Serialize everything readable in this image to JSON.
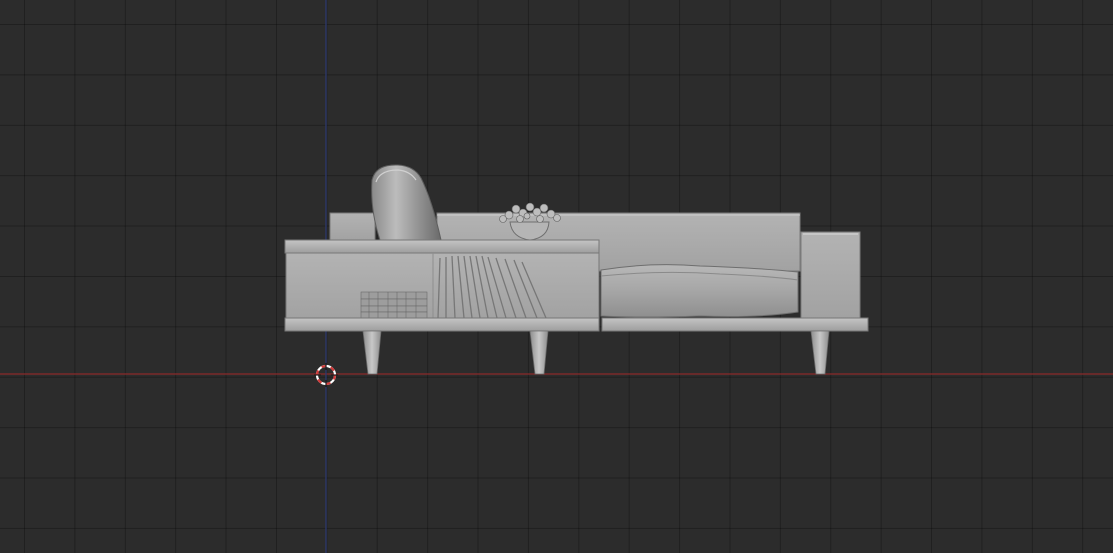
{
  "viewport": {
    "view": "orthographic",
    "colors": {
      "background": "#2c2c2c",
      "grid_line": "#222222",
      "x_axis": "#8a2a2a",
      "z_axis": "#2e3a6e",
      "model_surface": "#a9a9a9",
      "model_shadow": "#6e6e6e",
      "cursor_red": "#d23b3b",
      "cursor_white": "#ffffff"
    }
  },
  "scene": {
    "object": "sofa-with-bookshelf",
    "icons": [
      "3d-cursor-icon"
    ]
  }
}
